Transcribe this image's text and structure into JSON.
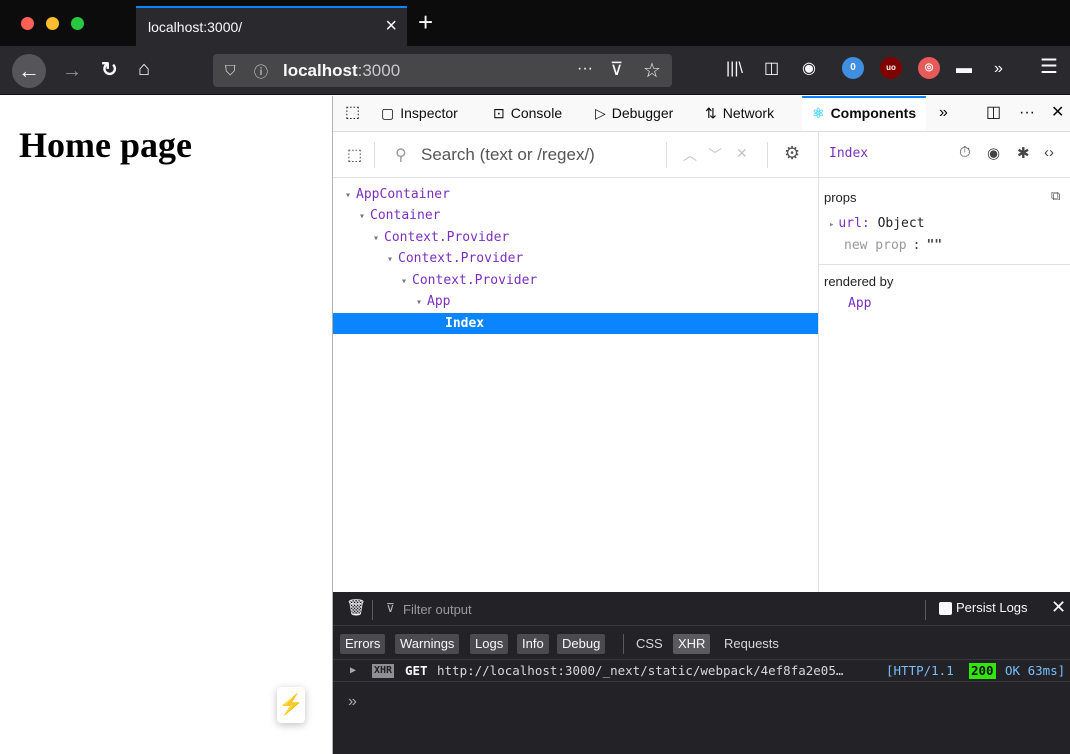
{
  "browser": {
    "tab_title": "localhost:3000/",
    "tab_close": "×",
    "new_tab": "+",
    "url_host": "localhost",
    "url_port": ":3000",
    "url_more": "···",
    "accent_color": "#0a84ff",
    "extensions": [
      {
        "name": "privacy-badger-icon",
        "badge": "0"
      },
      {
        "name": "ublock-icon",
        "badge": "uo"
      }
    ]
  },
  "page": {
    "heading": "Home page",
    "bolt_icon": "⚡"
  },
  "devtools": {
    "tabs": [
      {
        "label": "Inspector"
      },
      {
        "label": "Console"
      },
      {
        "label": "Debugger"
      },
      {
        "label": "Network"
      },
      {
        "label": "Components"
      }
    ],
    "components": {
      "search_placeholder": "Search (text or /regex/)",
      "tree": [
        {
          "label": "AppContainer"
        },
        {
          "label": "Container"
        },
        {
          "label": "Context.Provider"
        },
        {
          "label": "Context.Provider"
        },
        {
          "label": "Context.Provider"
        },
        {
          "label": "App"
        },
        {
          "label": "Index",
          "selected": true
        }
      ],
      "selected_name": "Index",
      "props_title": "props",
      "prop_key": "url:",
      "prop_value": "Object",
      "new_prop_label": "new prop",
      "new_prop_colon": ":",
      "new_prop_value": "\"\"",
      "rendered_by_title": "rendered by",
      "rendered_by_value": "App"
    },
    "console": {
      "filter_placeholder": "Filter output",
      "persist_logs_label": "Persist Logs",
      "filters": [
        "Errors",
        "Warnings",
        "Logs",
        "Info",
        "Debug",
        "CSS",
        "XHR",
        "Requests"
      ],
      "log": {
        "badge": "XHR",
        "method": "GET",
        "url": "http://localhost:3000/_next/static/webpack/4ef8fa2e05…",
        "protocol": "[HTTP/1.1",
        "status": "200",
        "status_text": "OK 63ms]"
      },
      "prompt": "»"
    }
  }
}
